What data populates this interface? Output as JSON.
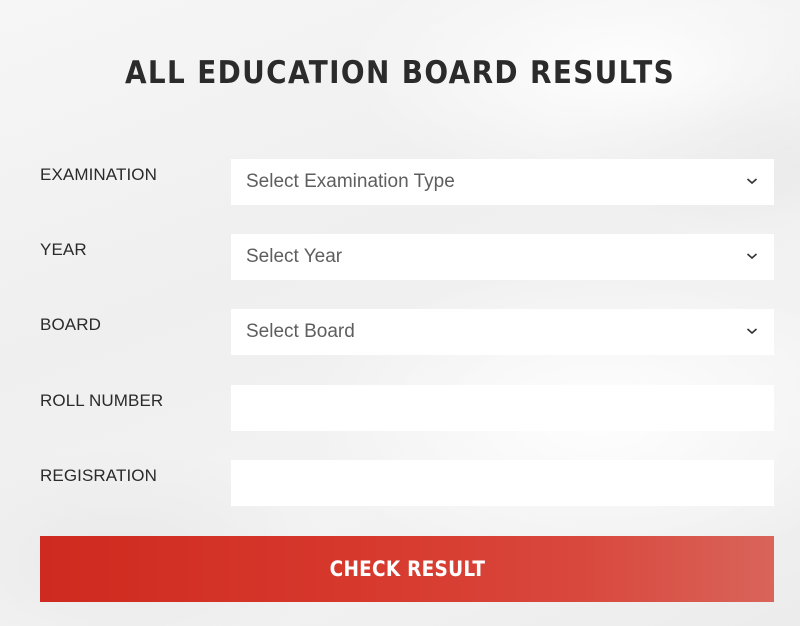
{
  "page": {
    "title": "ALL EDUCATION BOARD RESULTS"
  },
  "form": {
    "examination": {
      "label": "EXAMINATION",
      "selected": "Select Examination Type"
    },
    "year": {
      "label": "YEAR",
      "selected": "Select Year"
    },
    "board": {
      "label": "BOARD",
      "selected": "Select Board"
    },
    "roll_number": {
      "label": "ROLL NUMBER",
      "value": ""
    },
    "registration": {
      "label": "REGISRATION",
      "value": ""
    },
    "submit_label": "CHECK RESULT"
  },
  "icons": {
    "dropdown": "chevron-down-icon"
  },
  "colors": {
    "button": "#d33a2d",
    "title": "#2b2b2b",
    "background": "#f2f2f2",
    "field": "#ffffff"
  }
}
